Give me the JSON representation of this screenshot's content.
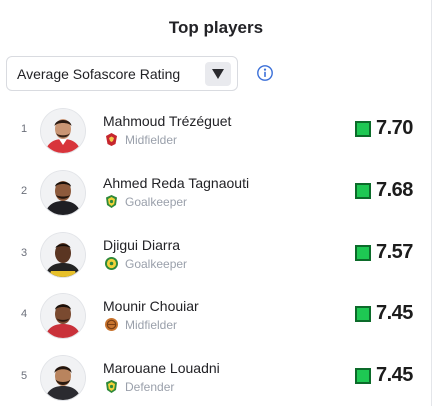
{
  "header": {
    "title": "Top players"
  },
  "filter": {
    "selected": "Average Sofascore Rating",
    "dropdown_icon": "caret-down-icon",
    "info_icon": "info-icon"
  },
  "colors": {
    "rating_high": "#1ec853",
    "rating_border": "#0c6b2a",
    "info_blue": "#3a6fd8"
  },
  "players": [
    {
      "rank": "1",
      "name": "Mahmoud Trézéguet",
      "position": "Midfielder",
      "team_logo": "red-eagle-crest-icon",
      "rating": "7.70"
    },
    {
      "rank": "2",
      "name": "Ahmed Reda Tagnaouti",
      "position": "Goalkeeper",
      "team_logo": "yellow-green-crest-icon",
      "rating": "7.68"
    },
    {
      "rank": "3",
      "name": "Djigui Diarra",
      "position": "Goalkeeper",
      "team_logo": "yellow-green-round-crest-icon",
      "rating": "7.57"
    },
    {
      "rank": "4",
      "name": "Mounir Chouiar",
      "position": "Midfielder",
      "team_logo": "orange-ball-crest-icon",
      "rating": "7.45"
    },
    {
      "rank": "5",
      "name": "Marouane Louadni",
      "position": "Defender",
      "team_logo": "yellow-green-crest-icon",
      "rating": "7.45"
    }
  ]
}
